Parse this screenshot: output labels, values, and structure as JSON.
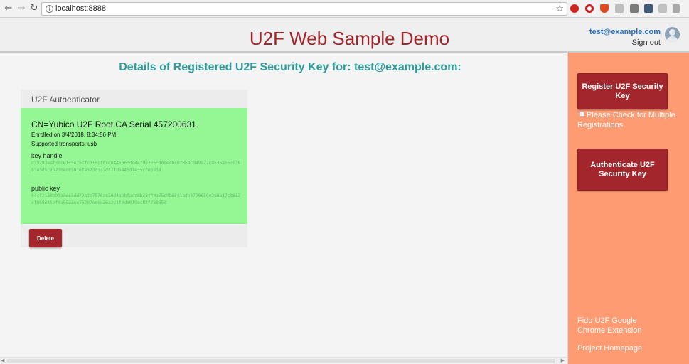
{
  "browser": {
    "url": "localhost:8888",
    "info_icon": "i",
    "extensions": [
      "abp-icon",
      "opera-icon",
      "shield-icon",
      "g-icon",
      "square-icon",
      "gear-icon",
      "person-icon",
      "video-icon"
    ]
  },
  "header": {
    "title": "U2F Web Sample Demo",
    "user_email": "test@example.com",
    "sign_out": "Sign out"
  },
  "main": {
    "heading": "Details of Registered U2F Security Key for: test@example.com:",
    "authenticator": {
      "title": "U2F Authenticator",
      "cn": "CN=Yubico U2F Root CA Serial 457200631",
      "enrolled": "Enrolled on 3/4/2018, 8:34:56 PM",
      "transports": "Supported transports: usb",
      "key_handle_label": "key handle",
      "key_handle_value": "d39293eef3dce7c5e75cfcd10cf0cd044606ddd4efde325cd09e4bc0f054cd49927c4535a552b2663a3d5c1623b4d85816fa523d377df7fd5445d1e35cfeb214",
      "public_key_label": "public key",
      "public_key_value": "04cf2139b99a3dc3dd79a1c7576ae3984abbfaec8b33440a75c9b8841adb4790050e2a8b17c8612ef868e15bf9a5923ee76287edee26a2c1f0da019ec82f78865d",
      "delete_label": "Delete"
    }
  },
  "sidebar": {
    "register_label": "Register U2F Security Key",
    "multi_label": "Please Check for Multiple Registrations",
    "authenticate_label": "Authenticate U2F Security Key",
    "fido_link": "Fido U2F Google Chrome Extension",
    "project_link": "Project Homepage"
  },
  "colors": {
    "brand_red": "#a2262c",
    "heading_teal": "#2e9b9b",
    "card_green": "#94f794",
    "sidebar_orange": "#fe9b73"
  }
}
